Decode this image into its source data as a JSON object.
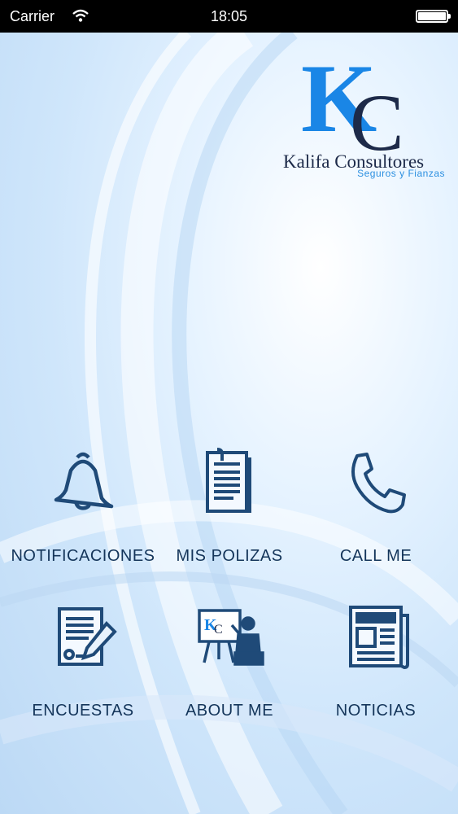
{
  "statusbar": {
    "carrier": "Carrier",
    "time": "18:05"
  },
  "logo": {
    "mark_k": "K",
    "mark_c": "C",
    "brand": "Kalifa Consultores",
    "tagline": "Seguros y Fianzas"
  },
  "menu": [
    {
      "label": "NOTIFICACIONES",
      "icon": "bell-icon"
    },
    {
      "label": "MIS POLIZAS",
      "icon": "document-icon"
    },
    {
      "label": "CALL ME",
      "icon": "phone-icon"
    },
    {
      "label": "ENCUESTAS",
      "icon": "survey-icon"
    },
    {
      "label": "ABOUT ME",
      "icon": "presentation-icon"
    },
    {
      "label": "NOTICIAS",
      "icon": "newspaper-icon"
    }
  ],
  "colors": {
    "icon": "#1f4a78",
    "label": "#14355a",
    "logo_blue": "#1a86e6",
    "logo_navy": "#1d2a49"
  }
}
